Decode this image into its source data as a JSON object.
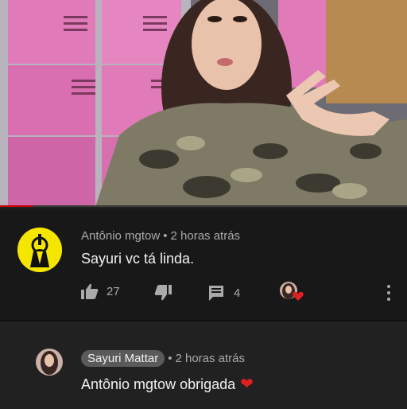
{
  "video": {
    "progress": 0.08
  },
  "comment": {
    "author": "Antônio mgtow",
    "separator": "•",
    "time": "2 horas atrás",
    "text": "Sayuri vc tá linda.",
    "likes": "27",
    "replies": "4"
  },
  "reply": {
    "author": "Sayuri Mattar",
    "separator": "•",
    "time": "2 horas atrás",
    "text": "Antônio mgtow obrigada"
  },
  "icons": {
    "like": "thumbs-up-icon",
    "dislike": "thumbs-down-icon",
    "reply": "comment-icon",
    "heart": "heart-icon",
    "more": "kebab-menu-icon"
  },
  "colors": {
    "background": "#212121",
    "comment_bg": "#181818",
    "accent_red": "#cc0000",
    "avatar_yellow": "#f5e600"
  }
}
